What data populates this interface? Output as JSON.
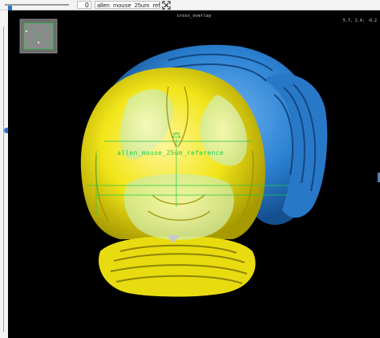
{
  "toolbar": {
    "index_value": "0",
    "volume_name": "allen_mouse_25um_reference"
  },
  "viewer": {
    "title": "cross_overlay",
    "coordinates": "5.7,    2.4,   -0.2",
    "overlay_label": "allen_mouse_25um_reference",
    "colors": {
      "annotation_blue": "#2c82d2",
      "reference_yellow": "#f2e61a",
      "crosshair_green": "#22c84a"
    }
  }
}
